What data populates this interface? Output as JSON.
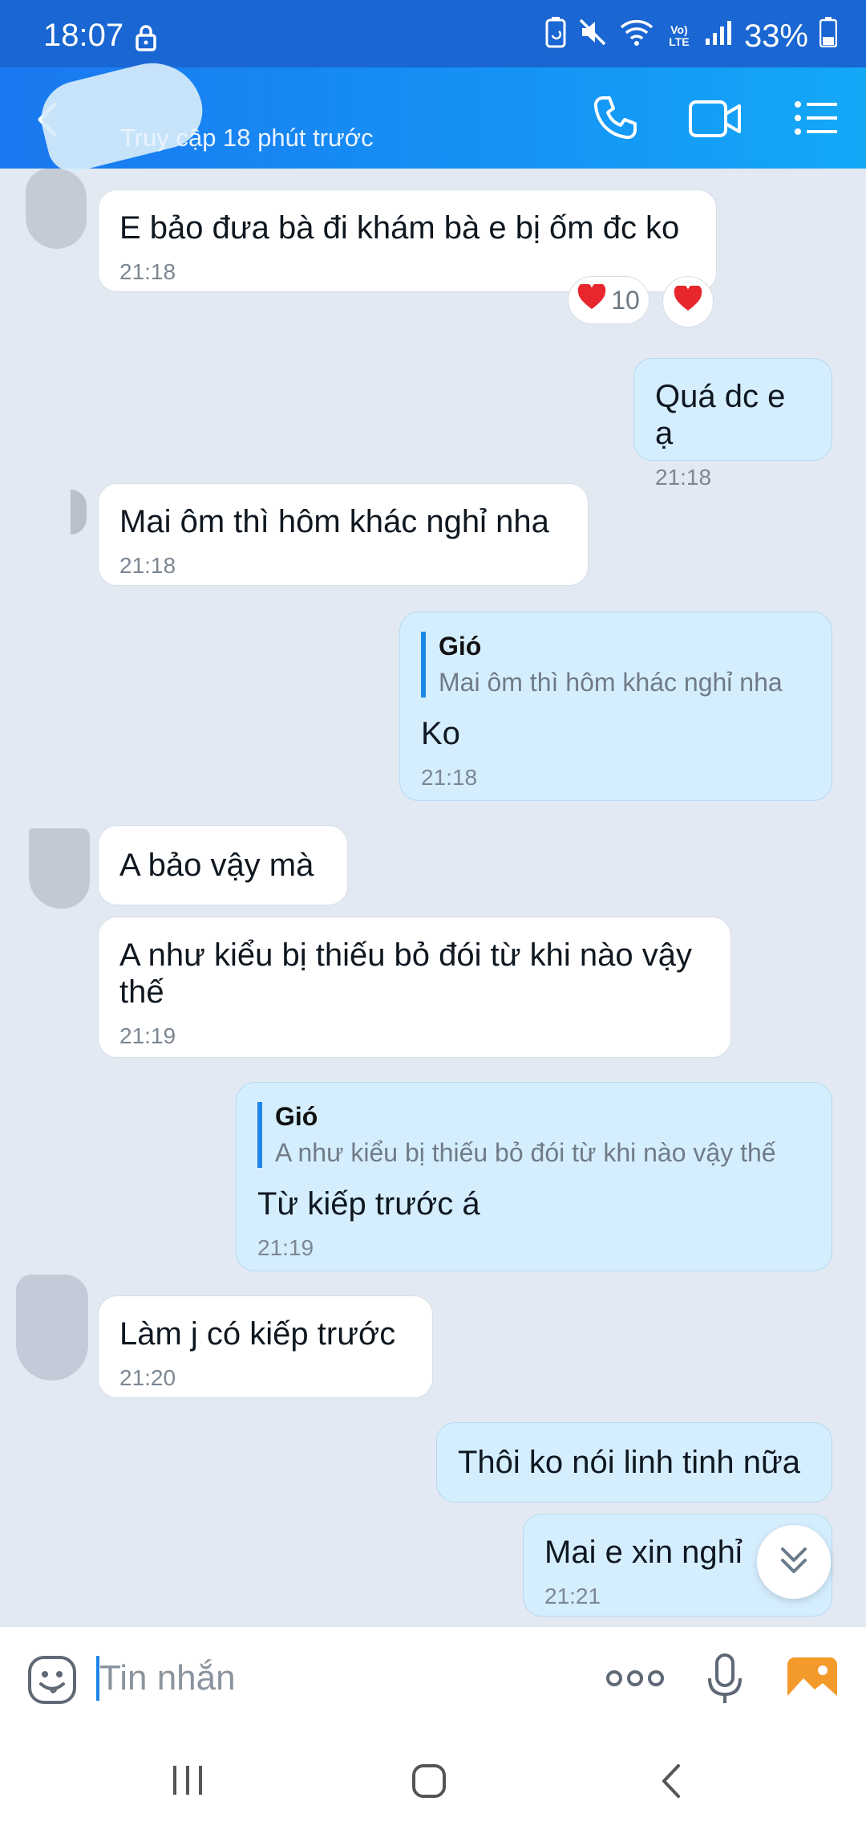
{
  "status_bar": {
    "time": "18:07",
    "battery": "33%",
    "network_label": "VoLTE"
  },
  "header": {
    "subtitle": "Truy cập 18 phút trước"
  },
  "messages": [
    {
      "text": "E bảo đưa bà đi khám bà e bị ốm đc ko",
      "time": "21:18",
      "reactions": [
        {
          "icon": "heart",
          "count": "10"
        },
        {
          "icon": "heart"
        }
      ]
    },
    {
      "text": "Quá dc e ạ",
      "time": "21:18"
    },
    {
      "text": "Mai ôm thì hôm khác nghỉ nha",
      "time": "21:18"
    },
    {
      "quote_name": "Gió",
      "quote_text": "Mai ôm thì hôm khác nghỉ nha",
      "text": "Ko",
      "time": "21:18"
    },
    {
      "text": "A bảo vậy mà"
    },
    {
      "text": "A như kiểu bị thiếu bỏ đói từ khi nào vậy thế",
      "time": "21:19"
    },
    {
      "quote_name": "Gió",
      "quote_text": "A như kiểu bị thiếu bỏ đói từ khi nào vậy thế",
      "text": "Từ kiếp trước á",
      "time": "21:19"
    },
    {
      "text": "Làm j có kiếp trước",
      "time": "21:20"
    },
    {
      "text": "Thôi ko nói linh tinh nữa"
    },
    {
      "text": "Mai e xin nghỉ",
      "time": "21:21"
    }
  ],
  "input": {
    "placeholder": "Tin nhắn"
  },
  "colors": {
    "header_start": "#1a78f0",
    "header_end": "#14a8f7",
    "status_bar": "#1a66d2",
    "outgoing_bubble": "#d5eefe",
    "incoming_bubble": "#ffffff",
    "chat_background": "#e2e9f2",
    "accent": "#1e86e8",
    "heart": "#e8262d",
    "image_button": "#f39a2b"
  },
  "icons": {
    "back": "chevron-left-icon",
    "call": "phone-icon",
    "video": "video-camera-icon",
    "menu": "list-menu-icon",
    "emoji": "emoji-icon",
    "more": "more-dots-icon",
    "mic": "microphone-icon",
    "image": "image-gallery-icon",
    "scroll_down": "double-chevron-down-icon"
  }
}
